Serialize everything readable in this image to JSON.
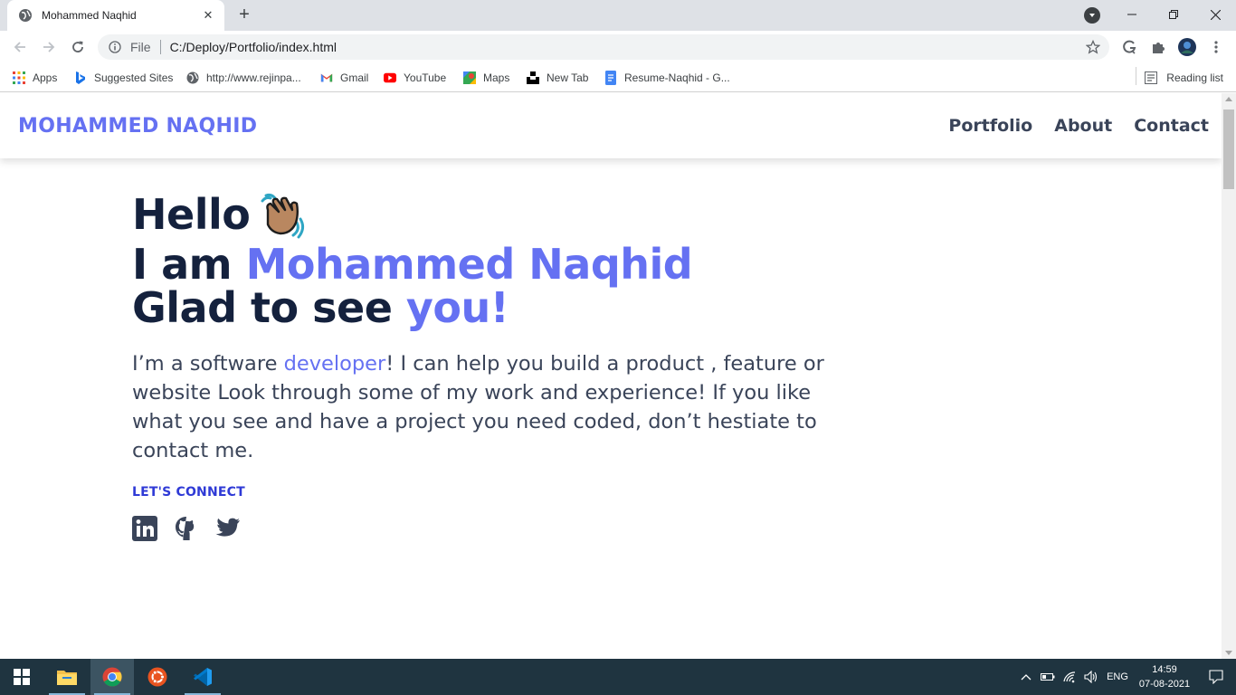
{
  "browser": {
    "tab_title": "Mohammed Naqhid",
    "url_scheme": "File",
    "url": "C:/Deploy/Portfolio/index.html",
    "bookmarks": [
      {
        "label": "Apps",
        "icon": "apps-grid-icon"
      },
      {
        "label": "Suggested Sites",
        "icon": "bing-icon"
      },
      {
        "label": "http://www.rejinpa...",
        "icon": "globe-icon"
      },
      {
        "label": "Gmail",
        "icon": "gmail-icon"
      },
      {
        "label": "YouTube",
        "icon": "youtube-icon"
      },
      {
        "label": "Maps",
        "icon": "maps-icon"
      },
      {
        "label": "New Tab",
        "icon": "unsplash-icon"
      },
      {
        "label": "Resume-Naqhid - G...",
        "icon": "google-docs-icon"
      }
    ],
    "reading_list": "Reading list"
  },
  "site": {
    "logo": "MOHAMMED NAQHID",
    "nav": [
      "Portfolio",
      "About",
      "Contact"
    ],
    "hero": {
      "line1": "Hello",
      "line2_prefix": "I am ",
      "line2_name": "Mohammed Naqhid",
      "line3_prefix": "Glad to see ",
      "line3_accent": "you!",
      "intro_prefix": "I’m a software ",
      "intro_accent": "developer",
      "intro_suffix": "! I can help you build a product , feature or website Look through some of my work and experience! If you like what you see and have a project you need coded, don’t hestiate to contact me.",
      "connect_label": "LET'S CONNECT"
    },
    "socials": [
      "linkedin-icon",
      "github-icon",
      "twitter-icon"
    ]
  },
  "taskbar": {
    "apps": [
      "start-icon",
      "file-explorer-icon",
      "chrome-icon",
      "ubuntu-icon",
      "vscode-icon"
    ],
    "language": "ENG",
    "time": "14:59",
    "date": "07-08-2021"
  },
  "colors": {
    "accent": "#6571f2",
    "heading": "#14213d",
    "body_text": "#3a4459",
    "connect": "#2f3ad6",
    "taskbar": "#1f3440"
  }
}
